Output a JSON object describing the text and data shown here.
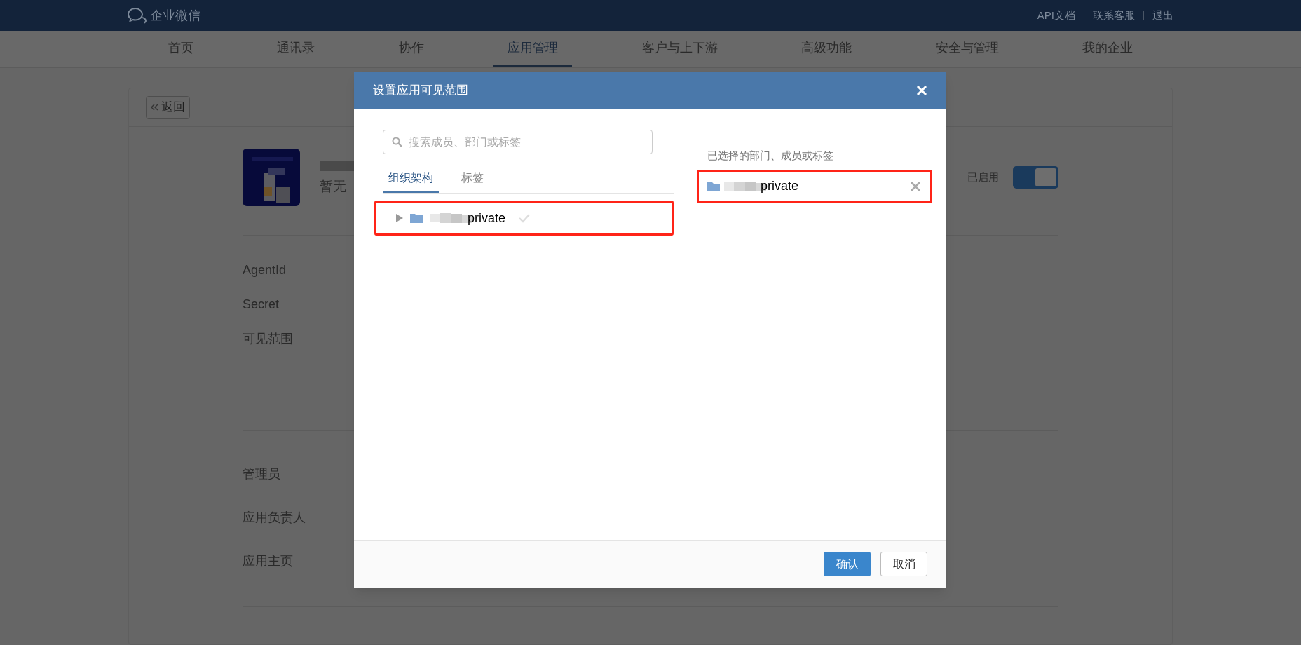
{
  "top_bar": {
    "logo": "企业微信",
    "links": [
      "API文档",
      "联系客服",
      "退出"
    ]
  },
  "nav": [
    {
      "label": "首页",
      "selected": false
    },
    {
      "label": "通讯录",
      "selected": false
    },
    {
      "label": "协作",
      "selected": false
    },
    {
      "label": "应用管理",
      "selected": true
    },
    {
      "label": "客户与上下游",
      "selected": false
    },
    {
      "label": "高级功能",
      "selected": false
    },
    {
      "label": "安全与管理",
      "selected": false
    },
    {
      "label": "我的企业",
      "selected": false
    }
  ],
  "page": {
    "back": "返回",
    "subtitle": "暂无",
    "status": "已启用",
    "enabled": true,
    "fields": [
      "AgentId",
      "Secret",
      "可见范围"
    ],
    "roles": [
      "管理员",
      "应用负责人",
      "应用主页"
    ]
  },
  "dialog": {
    "title": "设置应用可见范围",
    "search": {
      "placeholder": "搜索成员、部门或标签"
    },
    "tabs": [
      {
        "label": "组织架构",
        "selected": true
      },
      {
        "label": "标签",
        "selected": false
      }
    ],
    "tree": [
      {
        "label": "private",
        "expanded": false,
        "checked": false
      }
    ],
    "selected_heading": "已选择的部门、成员或标签",
    "selected_items": [
      {
        "label": "private"
      }
    ],
    "confirm": "确认",
    "cancel": "取消"
  }
}
